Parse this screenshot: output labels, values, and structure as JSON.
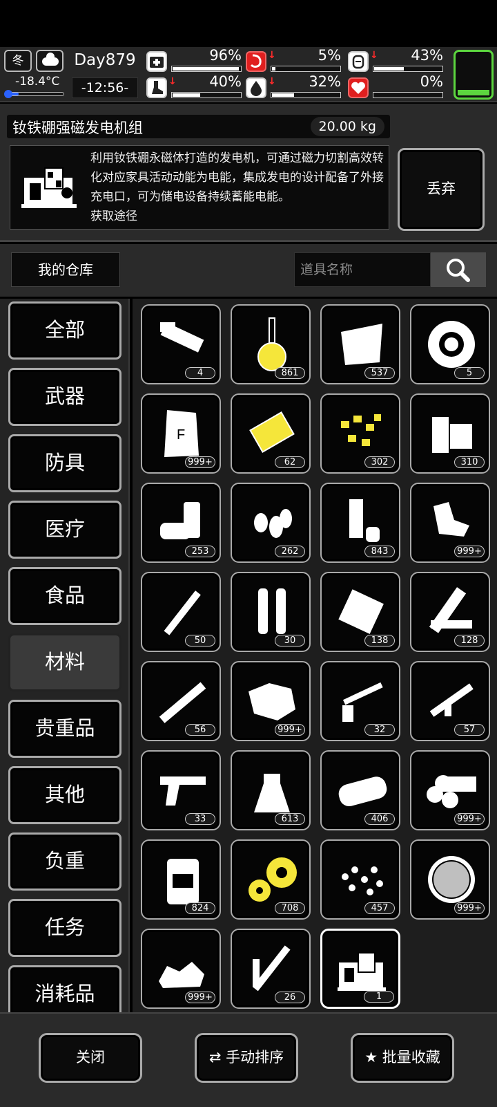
{
  "hud": {
    "season": "冬",
    "temperature": "-18.4°C",
    "day": "Day879",
    "time": "-12:56-",
    "stats": [
      {
        "name": "health",
        "value": "96%",
        "level": 96,
        "down": false
      },
      {
        "name": "hunger",
        "value": "5%",
        "level": 5,
        "down": true
      },
      {
        "name": "load",
        "value": "43%",
        "level": 43,
        "down": true
      },
      {
        "name": "stamina",
        "value": "40%",
        "level": 40,
        "down": true
      },
      {
        "name": "thirst",
        "value": "32%",
        "level": 32,
        "down": true
      },
      {
        "name": "mood",
        "value": "0%",
        "level": 0,
        "down": false
      }
    ]
  },
  "item": {
    "name": "钕铁硼强磁发电机组",
    "weight": "20.00 kg",
    "description": "利用钕铁硼永磁体打造的发电机，可通过磁力切割高效转化对应家具活动动能为电能，集成发电的设计配备了外接充电口，可为储电设备持续蓄能电能。",
    "description_cut": "获取途径",
    "discard_label": "丢弃"
  },
  "warehouse": {
    "title": "我的仓库",
    "search_placeholder": "道具名称"
  },
  "categories": [
    {
      "label": "全部",
      "active": false
    },
    {
      "label": "武器",
      "active": false
    },
    {
      "label": "防具",
      "active": false
    },
    {
      "label": "医疗",
      "active": false
    },
    {
      "label": "食品",
      "active": false
    },
    {
      "label": "材料",
      "active": true
    },
    {
      "label": "贵重品",
      "active": false
    },
    {
      "label": "其他",
      "active": false
    },
    {
      "label": "负重",
      "active": false
    },
    {
      "label": "任务",
      "active": false
    },
    {
      "label": "消耗品",
      "active": false
    }
  ],
  "items": [
    {
      "icon": "flashlight-parts-icon",
      "count": "4"
    },
    {
      "icon": "flask-icon",
      "count": "861"
    },
    {
      "icon": "cloth-sheet-icon",
      "count": "537"
    },
    {
      "icon": "tire-icon",
      "count": "5"
    },
    {
      "icon": "fertilizer-bag-icon",
      "count": "999+"
    },
    {
      "icon": "gold-plate-icon",
      "count": "62"
    },
    {
      "icon": "gold-nuggets-icon",
      "count": "302"
    },
    {
      "icon": "wood-blocks-icon",
      "count": "310"
    },
    {
      "icon": "cans-icon",
      "count": "253"
    },
    {
      "icon": "bullets-icon",
      "count": "262"
    },
    {
      "icon": "pipe-pieces-icon",
      "count": "843"
    },
    {
      "icon": "metal-scrap-icon",
      "count": "999+"
    },
    {
      "icon": "rod-part-icon",
      "count": "50"
    },
    {
      "icon": "cylinders-icon",
      "count": "30"
    },
    {
      "icon": "tarp-icon",
      "count": "138"
    },
    {
      "icon": "planks-icon",
      "count": "128"
    },
    {
      "icon": "tube-icon",
      "count": "56"
    },
    {
      "icon": "ore-icon",
      "count": "999+"
    },
    {
      "icon": "rifle-parts-icon",
      "count": "32"
    },
    {
      "icon": "assault-rifle-icon",
      "count": "57"
    },
    {
      "icon": "pistol-parts-icon",
      "count": "33"
    },
    {
      "icon": "beaker-icon",
      "count": "613"
    },
    {
      "icon": "log-icon",
      "count": "406"
    },
    {
      "icon": "logs-stack-icon",
      "count": "999+"
    },
    {
      "icon": "jerrycan-icon",
      "count": "824"
    },
    {
      "icon": "gears-icon",
      "count": "708"
    },
    {
      "icon": "pellets-icon",
      "count": "457"
    },
    {
      "icon": "mesh-disc-icon",
      "count": "999+"
    },
    {
      "icon": "gravel-icon",
      "count": "999+"
    },
    {
      "icon": "soldering-iron-icon",
      "count": "26"
    },
    {
      "icon": "generator-icon",
      "count": "1",
      "selected": true
    }
  ],
  "buttons": {
    "close": "关闭",
    "sort": "手动排序",
    "favorite": "批量收藏"
  },
  "colors": {
    "accent_yellow": "#f5e63a",
    "alert_red": "#e01f1f",
    "battery_green": "#5cd63f",
    "temp_blue": "#2a62ff"
  }
}
